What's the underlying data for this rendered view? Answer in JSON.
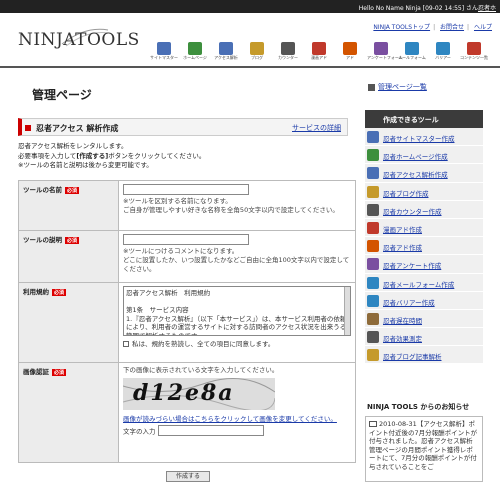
{
  "topbar": {
    "greeting": "Hello No Name Ninja [09-02 14:55] さん",
    "user_link": "忍者ホ"
  },
  "toplinks": [
    "NINJA TOOLSトップ",
    "お問合せ",
    "ヘルプ"
  ],
  "logo": "NINJATOOLS",
  "navicons": [
    {
      "label": "サイトマスター",
      "color": "#4a6fb5"
    },
    {
      "label": "ホームページ",
      "color": "#3d8f3d"
    },
    {
      "label": "アクセス解析",
      "color": "#4a6fb5"
    },
    {
      "label": "ブログ",
      "color": "#c59a2b"
    },
    {
      "label": "カウンター",
      "color": "#555555"
    },
    {
      "label": "漫画アド",
      "color": "#c0392b"
    },
    {
      "label": "アド",
      "color": "#d35400"
    },
    {
      "label": "アンケートフォーム",
      "color": "#7a4fa0"
    },
    {
      "label": "メールフォーム",
      "color": "#2e86c1"
    },
    {
      "label": "バリアー",
      "color": "#2e86c1"
    },
    {
      "label": "コンテンツ一覧",
      "color": "#c0392b"
    }
  ],
  "page_title": "管理ページ",
  "section": {
    "title": "忍者アクセス 解析作成",
    "detail_link": "サービスの詳細"
  },
  "intro": {
    "line1": "忍者アクセス解析をレンタルします。",
    "line2_pre": "必要事項を入力して",
    "line2_btn": "[作成する]",
    "line2_post": "ボタンをクリックしてください。",
    "line3": "※ツールの名前と説明は後から変更可能です。"
  },
  "form": {
    "required": "必須",
    "name": {
      "label": "ツールの名前",
      "hint1": "※ツールを区別する名前になります。",
      "hint2": "ご自身が管理しやすい好きな名称を全角50文字以内で設定してください。"
    },
    "desc": {
      "label": "ツールの説明",
      "hint1": "※ツールにつけるコメントになります。",
      "hint2": "どこに設置したか、いつ設置したかなどご自由に全角100文字以内で設定してください。"
    },
    "terms": {
      "label": "利用規約",
      "title": "忍者アクセス解析　利用規約",
      "article": "第1条　サービス内容",
      "body": "1.『忍者アクセス解析』（以下「本サービス」）は、本サービス利用者の依頼により、利用者の運営するサイトに対する訪問者のアクセス状況を出来うる範囲で解析するものです。",
      "agree": "私は、規約を熟読し、全ての項目に同意します。"
    },
    "captcha": {
      "label": "画像認証",
      "instruction": "下の画像に表示されている文字を入力してください。",
      "image_text": "d12e8a",
      "reload_link": "画像が読みづらい場合はこちらをクリックして画像を変更してください。",
      "input_label": "文字の入力"
    },
    "submit": "作成する"
  },
  "sidebar": {
    "mgmt_link": "管理ページ一覧",
    "tools_heading": "作成できるツール",
    "tools": [
      {
        "label": "忍者サイトマスター作成",
        "color": "#4a6fb5"
      },
      {
        "label": "忍者ホームページ作成",
        "color": "#3d8f3d"
      },
      {
        "label": "忍者アクセス解析作成",
        "color": "#4a6fb5"
      },
      {
        "label": "忍者ブログ作成",
        "color": "#c59a2b"
      },
      {
        "label": "忍者カウンター作成",
        "color": "#555555"
      },
      {
        "label": "漫画アド作成",
        "color": "#c0392b"
      },
      {
        "label": "忍者アド作成",
        "color": "#d35400"
      },
      {
        "label": "忍者アンケート作成",
        "color": "#7a4fa0"
      },
      {
        "label": "忍者メールフォーム作成",
        "color": "#2e86c1"
      },
      {
        "label": "忍者バリアー作成",
        "color": "#2e86c1"
      },
      {
        "label": "忍者遅在時間",
        "color": "#8e6b3a"
      },
      {
        "label": "忍者効果測定",
        "color": "#555555"
      },
      {
        "label": "忍者ブログ記事解析",
        "color": "#c59a2b"
      }
    ],
    "news_heading": "NINJA TOOLS からのお知らせ",
    "news_date": "2010-08-31",
    "news_tag": "【アクセス解析】",
    "news_body": "ポイント付近後の7月分報酬ポイントが付与されました。忍者アクセス解析管理ページの月間ポイント獲得レポートにて、7月分の報酬ポイントが付与されていることをご"
  }
}
